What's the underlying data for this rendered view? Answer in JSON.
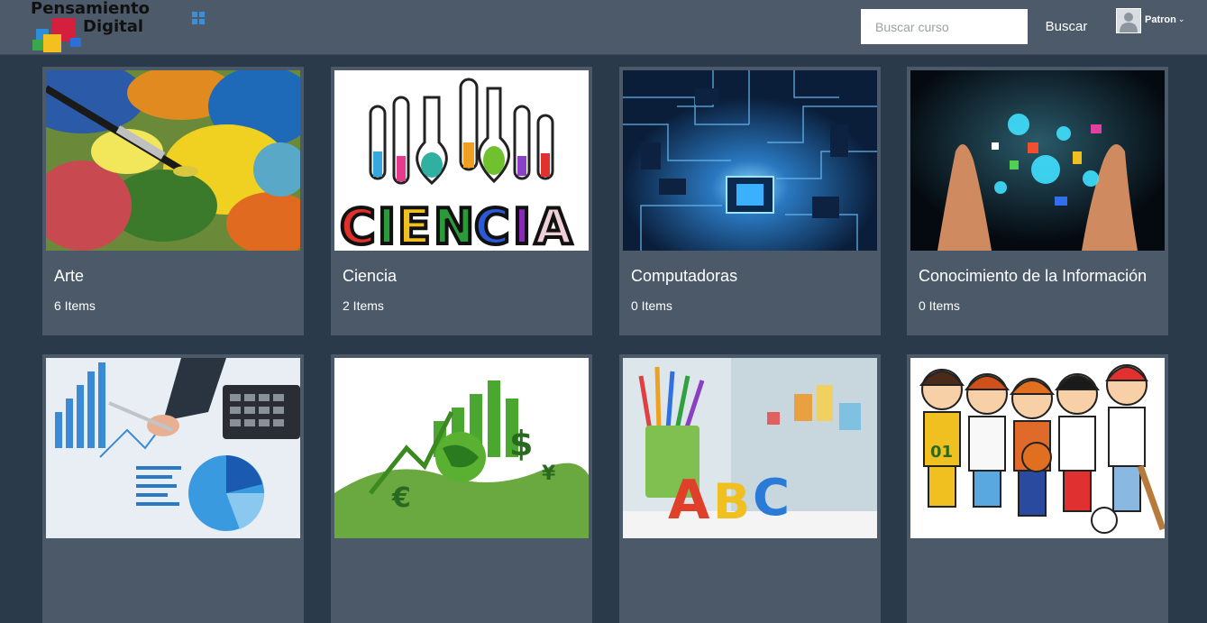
{
  "header": {
    "logo_line1": "Pensamiento",
    "logo_line2": "Digital",
    "search_placeholder": "Buscar curso",
    "search_value": "",
    "search_button": "Buscar",
    "user_name": "Patron"
  },
  "categories": [
    {
      "title": "Arte",
      "count": "6 Items",
      "image": "paint-palette-image"
    },
    {
      "title": "Ciencia",
      "count": "2 Items",
      "image": "ciencia-flasks-image"
    },
    {
      "title": "Computadoras",
      "count": "0 Items",
      "image": "circuit-board-image"
    },
    {
      "title": "Conocimiento de la Información",
      "count": "0 Items",
      "image": "hands-information-image"
    },
    {
      "title": "",
      "count": "",
      "image": "business-charts-image"
    },
    {
      "title": "",
      "count": "",
      "image": "economy-globe-image"
    },
    {
      "title": "",
      "count": "",
      "image": "abc-pencils-image"
    },
    {
      "title": "",
      "count": "",
      "image": "kids-sports-image"
    }
  ],
  "colors": {
    "background": "#2a3a4b",
    "topbar": "#4c5a6a",
    "card": "#4b5969",
    "accent": "#3b8fd9"
  }
}
